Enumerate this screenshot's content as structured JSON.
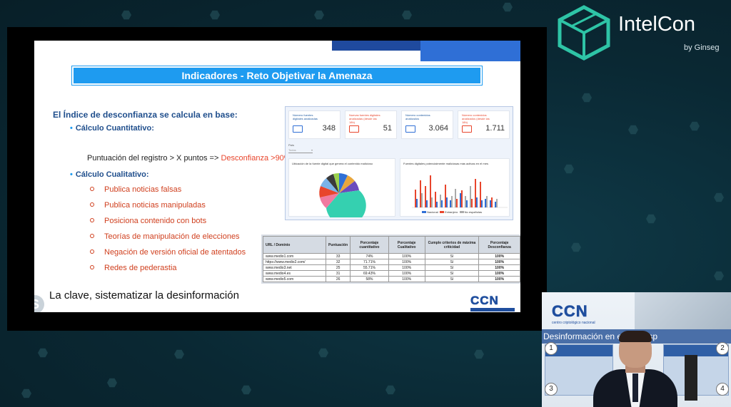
{
  "brand": {
    "name": "IntelCon",
    "sub": "by Ginseg"
  },
  "slide": {
    "title": "Indicadores - Reto Objetivar la Amenaza",
    "intro": "El Índice de desconfianza se calcula en base:",
    "quant_label": "Cálculo Cuantitativo:",
    "quant_text": "Puntuación del registro > X puntos =>",
    "quant_highlight": "Desconfianza >90%",
    "qual_label": "Cálculo Cualitativo:",
    "qual_items": [
      "Publica noticias falsas",
      "Publica noticias manipuladas",
      "Posiciona contenido con bots",
      "Teorías de manipulación de elecciones",
      "Negación de versión oficial de atentados",
      "Redes de pederastia"
    ],
    "conclusion": "La clave, sistematizar la desinformación"
  },
  "dashboard": {
    "kpis": [
      {
        "label": "Número fuentes digitales analizadas",
        "value": "348",
        "accent": "blue"
      },
      {
        "label": "Nuevas fuentes digitales analizadas (desde las 18h)",
        "value": "51",
        "accent": "red"
      },
      {
        "label": "Número contenidos analizados",
        "value": "3.064",
        "accent": "blue"
      },
      {
        "label": "Número contenidos analizados (desde las 18h)",
        "value": "1.711",
        "accent": "red"
      }
    ],
    "filter_label": "País",
    "filter_value": "Todos",
    "pie_title": "Ubicación de la fuente digital que genera el contenido malicioso",
    "bar_title": "Fuentes digitales potencialmente maliciosas más activas en el mes",
    "bar_legend": [
      "Nacional",
      "Extranjero",
      "No españolas"
    ]
  },
  "table": {
    "headers": [
      "URL / Dominio",
      "Puntuación",
      "Porcentaje cuantitativo",
      "Porcentaje Cualitativo",
      "Cumple criterios de máxima criticidad",
      "Porcentaje Desconfianza"
    ],
    "rows": [
      [
        "www.medio1.com",
        "33",
        "74%",
        "100%",
        "Sí",
        "100%"
      ],
      [
        "https://www.medio2.com/",
        "32",
        "71.71%",
        "100%",
        "Sí",
        "100%"
      ],
      [
        "www.medio3.net",
        "25",
        "55.71%",
        "100%",
        "Sí",
        "100%"
      ],
      [
        "www.medio4.es",
        "31",
        "69.43%",
        "100%",
        "Sí",
        "100%"
      ],
      [
        "www.medio5.com",
        "26",
        "58%",
        "100%",
        "Sí",
        "100%"
      ]
    ]
  },
  "ccn_logo": {
    "letters": "CCN",
    "sub": "centro criptológico nacional"
  },
  "webcam": {
    "slide_title": "Desinformación en el Cibeesp",
    "numbers": [
      "1",
      "2",
      "3",
      "4"
    ]
  },
  "colors": {
    "accent_blue": "#1e9bf0",
    "accent_red": "#e8452c",
    "nav_blue": "#1f4a9e"
  }
}
